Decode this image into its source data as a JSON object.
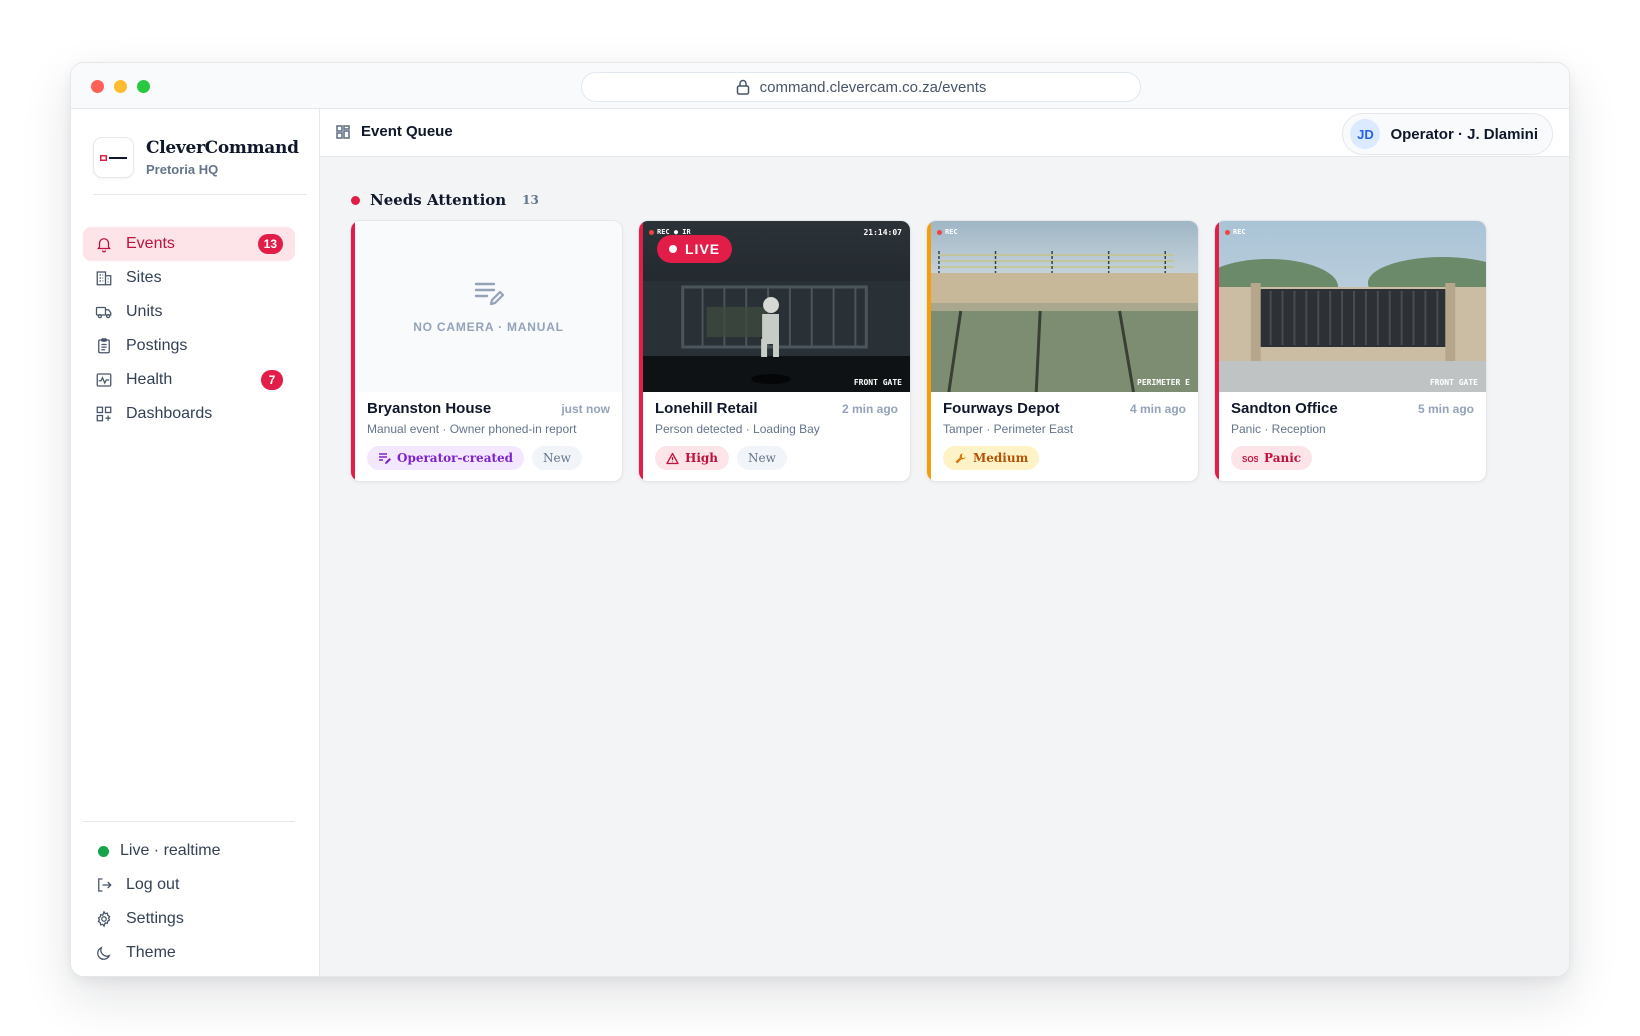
{
  "browser": {
    "url": "command.clevercam.co.za/events"
  },
  "brand": {
    "name": "CleverCommand",
    "sub": "Pretoria HQ"
  },
  "nav": [
    {
      "label": "Events",
      "icon": "bell-icon",
      "badge": "13",
      "active": true
    },
    {
      "label": "Sites",
      "icon": "building-icon"
    },
    {
      "label": "Units",
      "icon": "truck-icon"
    },
    {
      "label": "Postings",
      "icon": "clipboard-icon"
    },
    {
      "label": "Health",
      "icon": "pulse-icon",
      "badge": "7"
    },
    {
      "label": "Dashboards",
      "icon": "grid-icon"
    }
  ],
  "sidebar_bottom": {
    "status": "Live · realtime",
    "logout": "Log out",
    "settings": "Settings",
    "theme": "Theme"
  },
  "topbar": {
    "title": "Event Queue",
    "user_initials": "JD",
    "user_label": "Operator · J. Dlamini"
  },
  "section": {
    "title": "Needs Attention",
    "count": "13"
  },
  "cards": [
    {
      "site": "Bryanston House",
      "time": "just now",
      "desc": "Manual event · Owner phoned-in report",
      "placeholder": "NO CAMERA · MANUAL",
      "tags": [
        "Operator-created",
        "New"
      ],
      "stripe": "#e11d48"
    },
    {
      "site": "Lonehill Retail",
      "time": "2 min ago",
      "desc": "Person detected · Loading Bay",
      "live": "LIVE",
      "cam_rec": "REC ● IR",
      "cam_time": "21:14:07",
      "cam_label": "FRONT GATE",
      "tags": [
        "High",
        "New"
      ],
      "stripe": "#e11d48"
    },
    {
      "site": "Fourways Depot",
      "time": "4 min ago",
      "desc": "Tamper · Perimeter East",
      "cam_rec": "REC",
      "cam_label": "PERIMETER E",
      "tags": [
        "Medium"
      ],
      "stripe": "#f59e0b"
    },
    {
      "site": "Sandton Office",
      "time": "5 min ago",
      "desc": "Panic · Reception",
      "cam_rec": "REC",
      "cam_label": "FRONT GATE",
      "tags": [
        "Panic"
      ],
      "stripe": "#e11d48"
    }
  ]
}
